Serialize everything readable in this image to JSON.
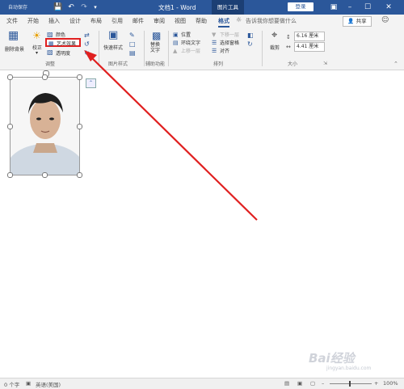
{
  "titlebar": {
    "autosave_label": "自动保存",
    "document_title": "文档1 - Word",
    "context_label": "图片工具",
    "signin": "登录",
    "undo_icon": "undo-icon",
    "save_icon": "save-icon"
  },
  "tabs": [
    "文件",
    "开始",
    "插入",
    "设计",
    "布局",
    "引用",
    "邮件",
    "审阅",
    "视图",
    "帮助",
    "格式"
  ],
  "tell_me": "告诉我你想要做什么",
  "share": "共享",
  "ribbon": {
    "remove_bg": "删除背景",
    "correct": "校正",
    "color": "颜色",
    "artistic": "艺术效果",
    "transparency": "透明度",
    "adjust_group": "调整",
    "quick_styles": "快速样式",
    "styles_group": "图片样式",
    "alt_text": "替换文字",
    "accessibility_group": "辅助功能",
    "position": "位置",
    "wrap_text": "环绕文字",
    "bring_forward": "上移一层",
    "send_backward": "下移一层",
    "selection_pane": "选择窗格",
    "align": "对齐",
    "arrange_group": "排列",
    "crop": "裁剪",
    "height": "6.16 厘米",
    "width": "4.41 厘米",
    "size_group": "大小"
  },
  "status": {
    "words": "0 个字",
    "language": "英语(美国)",
    "zoom": "100%"
  },
  "annotation": {
    "highlight_color": "#e02020",
    "arrow_color": "#e02020"
  },
  "watermark": {
    "text": "Bai经验",
    "sub": "jingyan.baidu.com"
  }
}
